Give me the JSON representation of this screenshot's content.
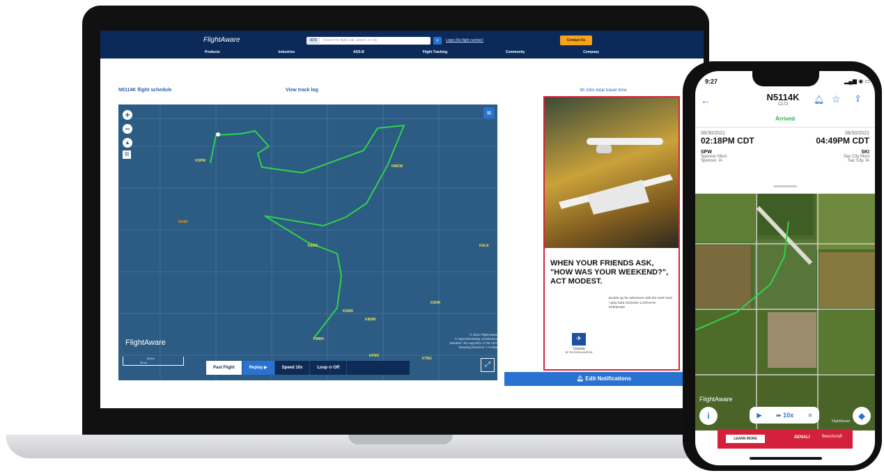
{
  "web": {
    "logo": "FlightAware",
    "search_chip": "ADS",
    "search_placeholder": "Search for flight, tail, airport, or city",
    "register_link": "Login (No flight number)",
    "contact_button": "Contact Us",
    "nav": [
      "Products",
      "Industries",
      "ADS-B",
      "Flight Tracking",
      "Community",
      "Company"
    ],
    "schedule_link": "N5114K flight schedule",
    "track_log_link": "View track log",
    "travel_time": "3h 10m total travel time",
    "edit_notifications": "Edit Notifications"
  },
  "map": {
    "airports": [
      "KSPW",
      "KMCW",
      "KOAY",
      "KEDG",
      "KALS",
      "KSHR",
      "KSWS",
      "KBNW",
      "KMMV",
      "KFNO",
      "KTNU"
    ],
    "logo": "FlightAware",
    "attribution": [
      "© 2021 FlightAware",
      "© OpenStreetMap contributors",
      "Weather: 30-Aug-2021 17:05 CDT",
      "Showing historical: 1-9-data"
    ],
    "scale_top": "50 km",
    "scale_bottom": "20 mi",
    "controls": {
      "past_flight": "Past Flight",
      "replay": "Replay",
      "speed_label": "Speed",
      "speed_value": "10x",
      "loop_label": "Loop",
      "loop_state": "Off"
    }
  },
  "ad": {
    "headline": "WHEN YOUR FRIENDS ASK, \"HOW WAS YOUR WEEKEND?\", ACT MODEST.",
    "body": "Buckle up for adventure with the work hard / play hard CESSNA CARAVAN turboprops.",
    "brand": "Cessna",
    "brand_sub": "BY TEXTRON AVIATION"
  },
  "phone": {
    "time": "9:27",
    "tail": "N5114K",
    "aircraft_type": "C172",
    "status": "Arrived",
    "departure": {
      "date": "08/30/2021",
      "time": "02:18PM CDT",
      "code": "SPW",
      "name": "Spencer Muni",
      "city": "Spencer, IA"
    },
    "arrival": {
      "date": "08/30/2021",
      "time": "04:49PM CDT",
      "code": "SKI",
      "name": "Sac City Muni",
      "city": "Sac City, IA"
    },
    "map_logo": "FlightAware",
    "map_watermark": "FlightAware",
    "speed": "10x",
    "ad_learn_more": "LEARN MORE",
    "ad_brand1": "DENALI",
    "ad_brand2": "Beechcraft"
  },
  "colors": {
    "navy": "#0b2a5a",
    "accent": "#2a72d0",
    "track": "#2fd44a",
    "arrived": "#2bb24c",
    "ad_red": "#d3213c",
    "contact": "#f7a21b"
  }
}
